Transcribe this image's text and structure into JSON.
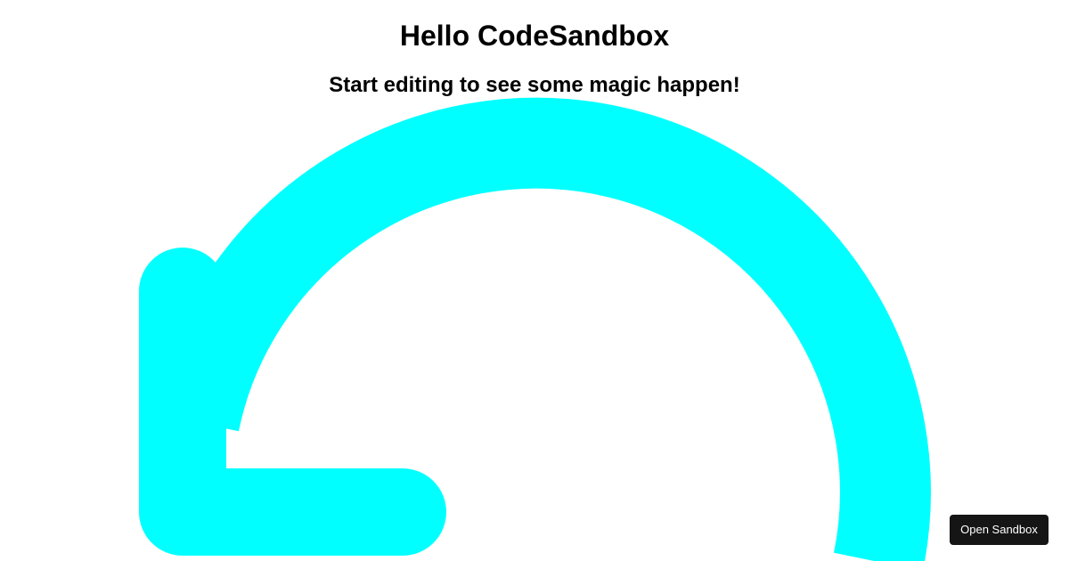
{
  "header": {
    "title": "Hello CodeSandbox",
    "subtitle": "Start editing to see some magic happen!"
  },
  "graphic": {
    "icon": "undo-arrow-icon",
    "color": "#00FFFF"
  },
  "footer": {
    "open_sandbox_label": "Open Sandbox",
    "button_bg": "#151515",
    "button_fg": "#FFFFFF"
  }
}
